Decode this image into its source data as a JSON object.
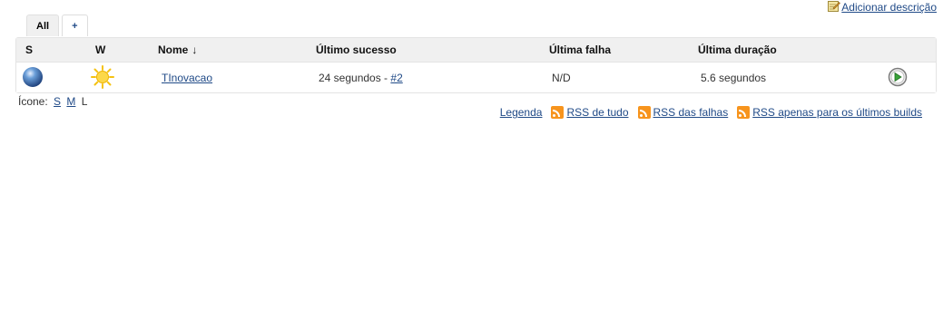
{
  "header": {
    "add_description": "Adicionar descrição"
  },
  "tabs": [
    {
      "label": "All",
      "active": true
    },
    {
      "label": "+",
      "active": false
    }
  ],
  "table": {
    "columns": {
      "s": "S",
      "w": "W",
      "nome": "Nome",
      "nome_sort": "↓",
      "ultimo_sucesso": "Último sucesso",
      "ultima_falha": "Última falha",
      "ultima_duracao": "Última duração"
    },
    "rows": [
      {
        "status_icon": "blue-ball-icon",
        "weather_icon": "sunny-icon",
        "nome": "TInovacao",
        "ultimo_sucesso_text": "24 segundos - ",
        "ultimo_sucesso_link": "#2",
        "ultima_falha": "N/D",
        "ultima_duracao": "5.6 segundos",
        "action_icon": "schedule-build-icon"
      }
    ]
  },
  "icon_size": {
    "label": "Ícone:",
    "options": [
      "S",
      "M",
      "L"
    ],
    "current": "L"
  },
  "footer_links": {
    "legend": "Legenda",
    "rss_all": "RSS de tudo",
    "rss_failures": "RSS das falhas",
    "rss_latest": "RSS apenas para os últimos builds"
  },
  "colors": {
    "link": "#204a87",
    "header_bg": "#f0f0f0",
    "rss_orange": "#f7941d"
  }
}
